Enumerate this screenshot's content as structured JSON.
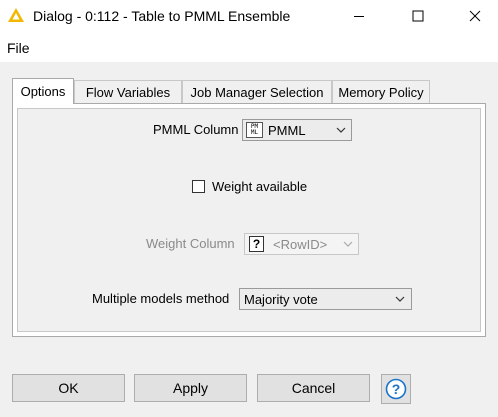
{
  "window": {
    "title": "Dialog - 0:112 - Table to PMML Ensemble"
  },
  "menu": {
    "file": "File"
  },
  "tabs": [
    {
      "label": "Options",
      "active": true
    },
    {
      "label": "Flow Variables",
      "active": false
    },
    {
      "label": "Job Manager Selection",
      "active": false
    },
    {
      "label": "Memory Policy",
      "active": false
    }
  ],
  "options": {
    "pmml_column": {
      "label": "PMML Column",
      "value": "PMML",
      "icon": "pmml-type-icon",
      "icon_text": "PM ML"
    },
    "weight_available": {
      "label": "Weight available",
      "checked": false
    },
    "weight_column": {
      "label": "Weight Column",
      "value": "<RowID>",
      "icon": "unknown-type-icon",
      "icon_text": "?",
      "enabled": false
    },
    "multiple_models_method": {
      "label": "Multiple models method",
      "value": "Majority vote"
    }
  },
  "buttons": {
    "ok": "OK",
    "apply": "Apply",
    "cancel": "Cancel",
    "help_icon": "help-icon"
  },
  "colors": {
    "accent": "#1a73c9",
    "title_icon": "#f2b800"
  }
}
